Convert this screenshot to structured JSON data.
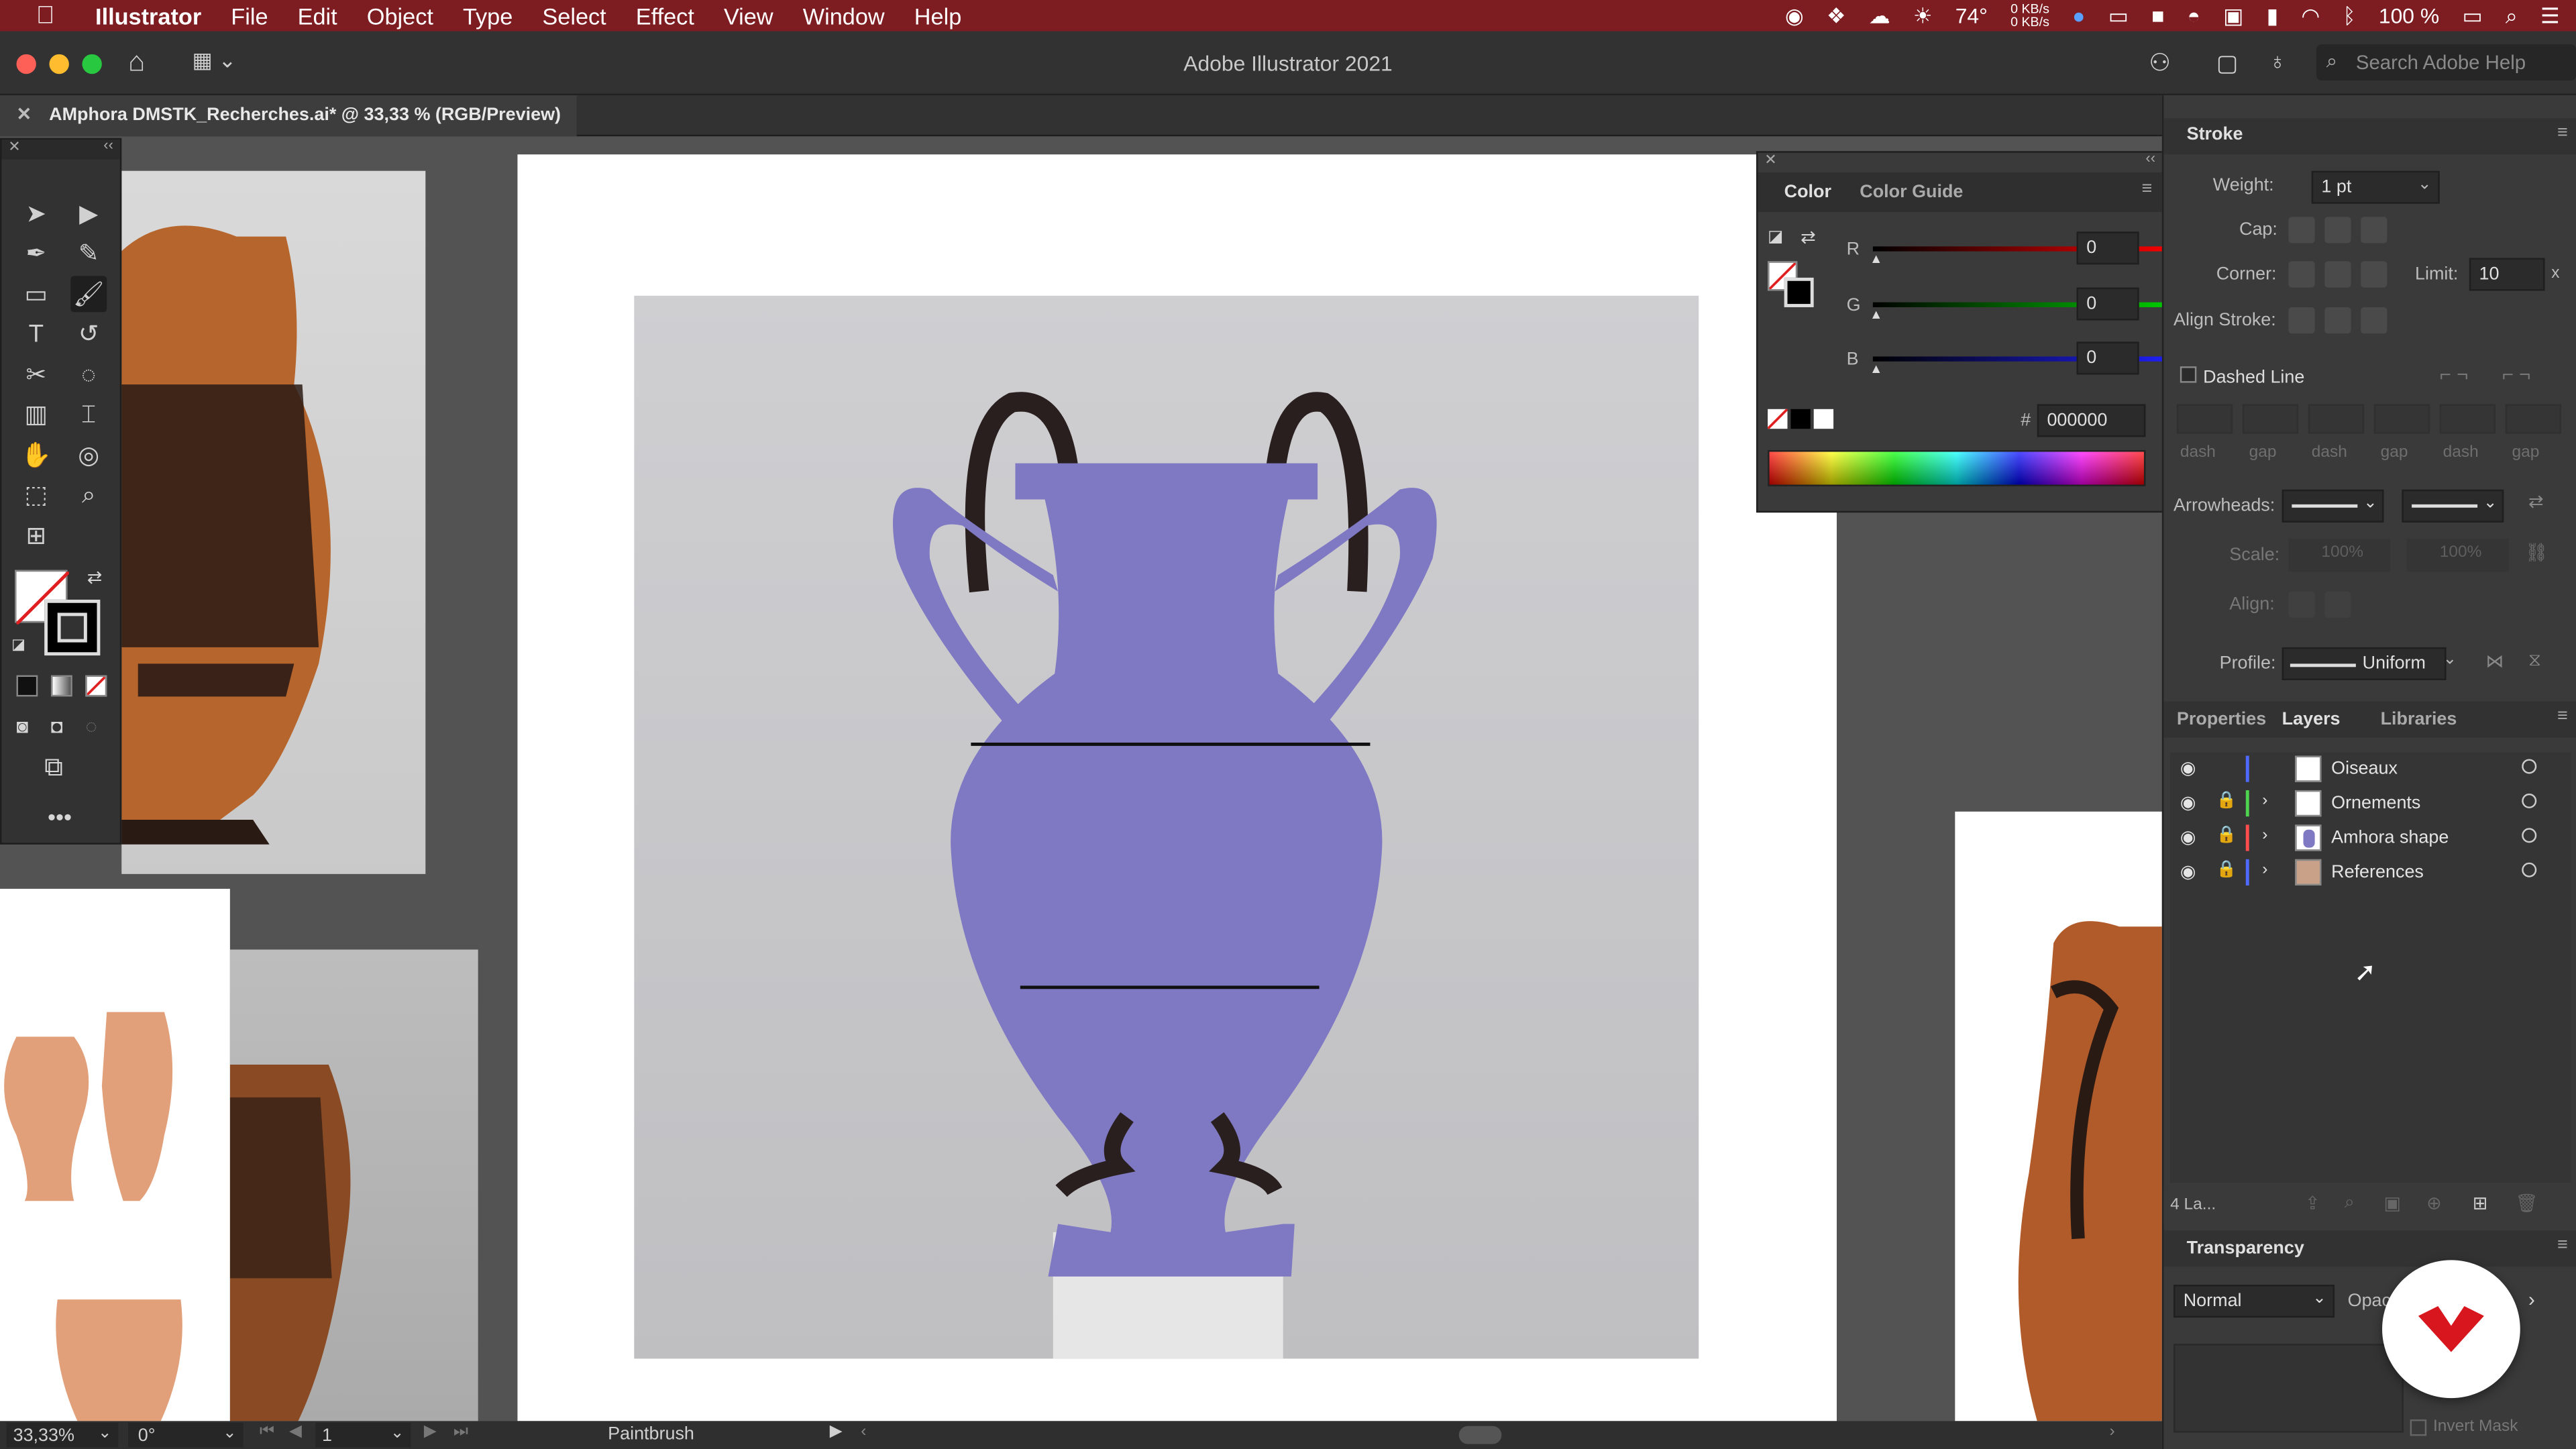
{
  "menubar": {
    "app": "Illustrator",
    "items": [
      "File",
      "Edit",
      "Object",
      "Type",
      "Select",
      "Effect",
      "View",
      "Window",
      "Help"
    ],
    "temperature": "74°",
    "net_up": "0 KB/s",
    "net_down": "0 KB/s",
    "battery": "100 %"
  },
  "appbar": {
    "title": "Adobe Illustrator 2021",
    "search_placeholder": "Search Adobe Help"
  },
  "document": {
    "tab_title": "AMphora DMSTK_Recherches.ai* @ 33,33 % (RGB/Preview)"
  },
  "color_panel": {
    "tabs": [
      "Color",
      "Color Guide"
    ],
    "r_label": "R",
    "r_value": "0",
    "g_label": "G",
    "g_value": "0",
    "b_label": "B",
    "b_value": "0",
    "hash": "#",
    "hex": "000000"
  },
  "stroke_panel": {
    "title": "Stroke",
    "weight_label": "Weight:",
    "weight_value": "1 pt",
    "cap_label": "Cap:",
    "corner_label": "Corner:",
    "limit_label": "Limit:",
    "limit_value": "10",
    "align_label": "Align Stroke:",
    "dashed_label": "Dashed Line",
    "dash_fields": [
      "dash",
      "gap",
      "dash",
      "gap",
      "dash",
      "gap"
    ],
    "arrowheads_label": "Arrowheads:",
    "scale_label": "Scale:",
    "scale_1": "100%",
    "scale_2": "100%",
    "align2_label": "Align:",
    "profile_label": "Profile:",
    "profile_value": "Uniform"
  },
  "layers_panel": {
    "tabs": [
      "Properties",
      "Layers",
      "Libraries"
    ],
    "layers": [
      {
        "name": "Oiseaux",
        "color": "#4f6bff"
      },
      {
        "name": "Ornements",
        "color": "#4fd24f"
      },
      {
        "name": "Amhora shape",
        "color": "#ff4d4d"
      },
      {
        "name": "References",
        "color": "#4f6bff"
      }
    ],
    "count": "4 La..."
  },
  "transparency_panel": {
    "title": "Transparency",
    "blend_mode": "Normal",
    "opacity_label": "Opac",
    "invert_mask": "Invert Mask"
  },
  "statusbar": {
    "zoom": "33,33%",
    "rotation": "0°",
    "artboard": "1",
    "tool": "Paintbrush"
  },
  "colors": {
    "menubar": "#7d1d22",
    "amphora_fill": "#7f79c4",
    "panel_bg": "#3a3a3a"
  }
}
